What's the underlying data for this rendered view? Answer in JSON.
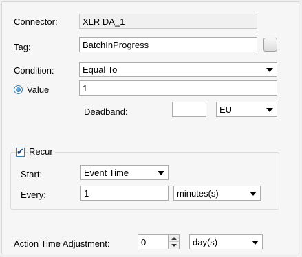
{
  "connector": {
    "label": "Connector:",
    "value": "XLR DA_1"
  },
  "tag": {
    "label": "Tag:",
    "value": "BatchInProgress"
  },
  "condition": {
    "label": "Condition:",
    "value": "Equal To"
  },
  "value_row": {
    "label": "Value",
    "value": "1",
    "selected": true
  },
  "deadband": {
    "label": "Deadband:",
    "value": "",
    "unit": "EU"
  },
  "recur": {
    "label": "Recur",
    "checked": true,
    "start_label": "Start:",
    "start_value": "Event Time",
    "every_label": "Every:",
    "every_value": "1",
    "every_unit": "minutes(s)"
  },
  "action_time": {
    "label": "Action Time Adjustment:",
    "value": "0",
    "unit": "day(s)"
  }
}
